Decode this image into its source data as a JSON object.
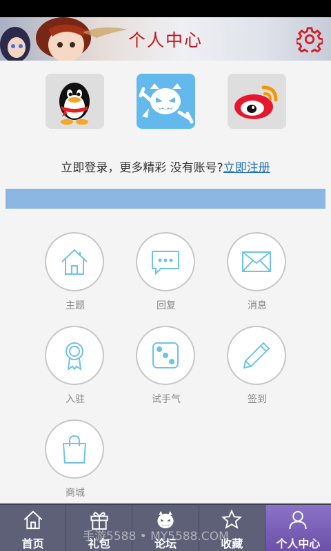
{
  "header": {
    "title": "个人中心",
    "settings_icon": "gear-icon"
  },
  "login_options": [
    {
      "name": "qq-login",
      "icon": "qq-penguin-icon",
      "bg": "#dedede"
    },
    {
      "name": "app-login",
      "icon": "devil-mascot-icon",
      "bg": "#63b8ec"
    },
    {
      "name": "weibo-login",
      "icon": "weibo-icon",
      "bg": "#dedede"
    }
  ],
  "prompt": {
    "text": "立即登录，更多精彩  没有账号?",
    "register_link": "立即注册"
  },
  "menu": [
    {
      "label": "主题",
      "icon": "home-icon"
    },
    {
      "label": "回复",
      "icon": "chat-bubble-icon"
    },
    {
      "label": "消息",
      "icon": "envelope-icon"
    },
    {
      "label": "入驻",
      "icon": "badge-icon"
    },
    {
      "label": "试手气",
      "icon": "dice-icon"
    },
    {
      "label": "签到",
      "icon": "pencil-icon"
    },
    {
      "label": "商城",
      "icon": "shopping-bag-icon"
    }
  ],
  "tabs": [
    {
      "label": "首页",
      "icon": "home-icon",
      "active": false
    },
    {
      "label": "礼包",
      "icon": "gift-icon",
      "active": false
    },
    {
      "label": "论坛",
      "icon": "devil-mascot-icon",
      "active": false
    },
    {
      "label": "收藏",
      "icon": "star-icon",
      "active": false
    },
    {
      "label": "个人中心",
      "icon": "person-icon",
      "active": true
    }
  ],
  "watermark": "手游5588 • MY5588.COM",
  "colors": {
    "accent_blue": "#8cb7e2",
    "title_red": "#c8141a",
    "link_blue": "#1f6fb4",
    "tab_bg": "#5e6078",
    "tab_active": "#7a5fb8"
  }
}
